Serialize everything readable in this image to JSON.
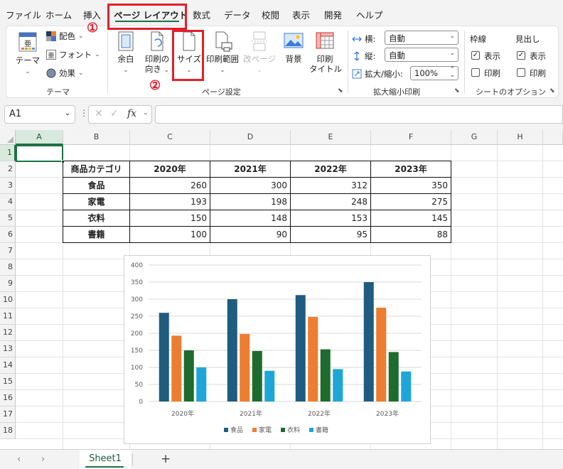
{
  "menu": {
    "items": [
      "ファイル",
      "ホーム",
      "挿入",
      "ページ レイアウト",
      "数式",
      "データ",
      "校閲",
      "表示",
      "開発",
      "ヘルプ"
    ],
    "active": "ページ レイアウト"
  },
  "annotations": {
    "step1": "①",
    "step2": "②",
    "color": "#e0202a"
  },
  "ribbon": {
    "theme": {
      "themes": "テーマ",
      "colors": "配色",
      "fonts": "フォント",
      "effects": "効果",
      "group_label": "テーマ"
    },
    "page_setup": {
      "margins": "余白",
      "orientation_line1": "印刷の",
      "orientation_line2": "向き",
      "size": "サイズ",
      "print_area": "印刷範囲",
      "breaks": "改ページ",
      "background": "背景",
      "print_titles_line1": "印刷",
      "print_titles_line2": "タイトル",
      "group_label": "ページ設定"
    },
    "scale": {
      "width_label": "横:",
      "width_value": "自動",
      "height_label": "縦:",
      "height_value": "自動",
      "scale_label": "拡大/縮小:",
      "scale_value": "100%",
      "group_label": "拡大縮小印刷"
    },
    "sheet_options": {
      "gridlines": "枠線",
      "headings": "見出し",
      "view": "表示",
      "print": "印刷",
      "gridlines_view": true,
      "gridlines_print": false,
      "headings_view": true,
      "headings_print": false,
      "group_label": "シートのオプション"
    }
  },
  "formula_bar": {
    "name_box": "A1",
    "fx": "fx",
    "formula": ""
  },
  "columns": [
    "A",
    "B",
    "C",
    "D",
    "E",
    "F",
    "G",
    "H"
  ],
  "rows": [
    "1",
    "2",
    "3",
    "4",
    "5",
    "6",
    "7",
    "8",
    "9",
    "10",
    "11",
    "12",
    "13",
    "14",
    "15",
    "16",
    "17",
    "18"
  ],
  "table": {
    "header": [
      "商品カテゴリ",
      "2020年",
      "2021年",
      "2022年",
      "2023年"
    ],
    "rows": [
      [
        "食品",
        "260",
        "300",
        "312",
        "350"
      ],
      [
        "家電",
        "193",
        "198",
        "248",
        "275"
      ],
      [
        "衣料",
        "150",
        "148",
        "153",
        "145"
      ],
      [
        "書籍",
        "100",
        "90",
        "95",
        "88"
      ]
    ]
  },
  "chart_data": {
    "type": "bar",
    "categories": [
      "2020年",
      "2021年",
      "2022年",
      "2023年"
    ],
    "series": [
      {
        "name": "食品",
        "values": [
          260,
          300,
          312,
          350
        ],
        "color": "#1f5c7f"
      },
      {
        "name": "家電",
        "values": [
          193,
          198,
          248,
          275
        ],
        "color": "#ed7d31"
      },
      {
        "name": "衣料",
        "values": [
          150,
          148,
          153,
          145
        ],
        "color": "#1e6b2e"
      },
      {
        "name": "書籍",
        "values": [
          100,
          90,
          95,
          88
        ],
        "color": "#1ea6d8"
      }
    ],
    "yticks": [
      "0",
      "50",
      "100",
      "150",
      "200",
      "250",
      "300",
      "350",
      "400"
    ],
    "ylim": [
      0,
      400
    ],
    "grid": true,
    "legend": "bottom",
    "title": "",
    "xlabel": "",
    "ylabel": ""
  },
  "sheet_tabs": {
    "tabs": [
      "Sheet1"
    ],
    "add": "+"
  }
}
